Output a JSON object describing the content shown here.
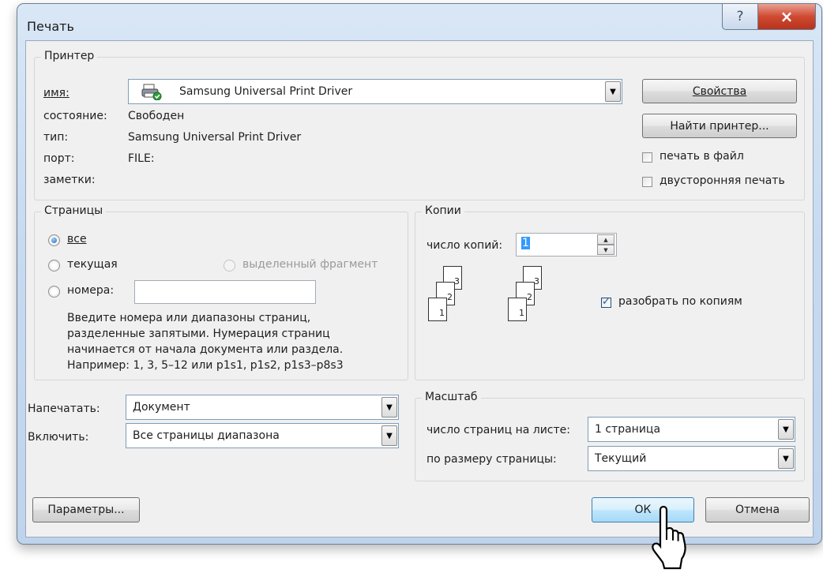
{
  "window": {
    "title": "Печать",
    "help_icon": "?",
    "close_icon": "×"
  },
  "printer": {
    "group_title": "Принтер",
    "name_label": "имя:",
    "name_value": "Samsung Universal Print Driver",
    "status_label": "состояние:",
    "status_value": "Свободен",
    "type_label": "тип:",
    "type_value": "Samsung Universal Print Driver",
    "port_label": "порт:",
    "port_value": "FILE:",
    "notes_label": "заметки:",
    "properties_button": "Свойства",
    "find_printer_button": "Найти принтер...",
    "print_to_file_label": "печать в файл",
    "print_to_file_checked": false,
    "duplex_label": "двусторонняя печать",
    "duplex_checked": false
  },
  "pages": {
    "group_title": "Страницы",
    "all_label": "все",
    "current_label": "текущая",
    "selection_label": "выделенный фрагмент",
    "numbers_label": "номера:",
    "numbers_value": "",
    "selected": "all",
    "hint_lines": [
      "Введите номера или диапазоны страниц,",
      "разделенные запятыми. Нумерация страниц",
      "начинается от начала документа или раздела.",
      "Например: 1, 3, 5–12 или p1s1, p1s2, p1s3–p8s3"
    ]
  },
  "copies": {
    "group_title": "Копии",
    "count_label": "число копий:",
    "count_value": "1",
    "collate_label": "разобрать по копиям",
    "collate_checked": true,
    "page_numbers": [
      "3",
      "2",
      "1"
    ]
  },
  "print_what": {
    "label": "Напечатать:",
    "value": "Документ"
  },
  "include": {
    "label": "Включить:",
    "value": "Все страницы диапазона"
  },
  "zoom": {
    "group_title": "Масштаб",
    "pages_per_sheet_label": "число страниц на листе:",
    "pages_per_sheet_value": "1 страница",
    "scale_label": "по размеру страницы:",
    "scale_value": "Текущий"
  },
  "footer": {
    "options_button": "Параметры...",
    "ok_button": "ОК",
    "cancel_button": "Отмена"
  },
  "colors": {
    "accent": "#3c7fb1",
    "close": "#c8432b",
    "frame": "#c7daf0"
  }
}
